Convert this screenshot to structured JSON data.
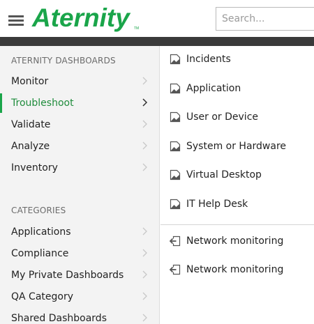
{
  "header": {
    "logo_text": "Aternity",
    "search_placeholder": "Search..."
  },
  "colors": {
    "brand_green": "#1aa54a",
    "dark_bar": "#3a3a3a",
    "sidebar_bg": "#f3f3f3"
  },
  "sidebar": {
    "dashboards_header": "ATERNITY DASHBOARDS",
    "dashboard_items": [
      {
        "label": "Monitor",
        "active": false
      },
      {
        "label": "Troubleshoot",
        "active": true
      },
      {
        "label": "Validate",
        "active": false
      },
      {
        "label": "Analyze",
        "active": false
      },
      {
        "label": "Inventory",
        "active": false
      }
    ],
    "categories_header": "CATEGORIES",
    "category_items": [
      {
        "label": "Applications"
      },
      {
        "label": "Compliance"
      },
      {
        "label": "My Private Dashboards"
      },
      {
        "label": "QA Category"
      },
      {
        "label": "Shared Dashboards"
      }
    ]
  },
  "content": {
    "dashboards": [
      {
        "label": "Incidents",
        "icon": "dashboard-page-icon"
      },
      {
        "label": "Application",
        "icon": "dashboard-page-icon"
      },
      {
        "label": "User or Device",
        "icon": "dashboard-page-icon"
      },
      {
        "label": "System or Hardware",
        "icon": "dashboard-page-icon"
      },
      {
        "label": "Virtual Desktop",
        "icon": "dashboard-page-icon"
      },
      {
        "label": "IT Help Desk",
        "icon": "dashboard-page-icon"
      }
    ],
    "links": [
      {
        "label": "Network monitoring",
        "icon": "external-link-icon"
      },
      {
        "label": "Network monitoring",
        "icon": "external-link-icon"
      }
    ]
  }
}
